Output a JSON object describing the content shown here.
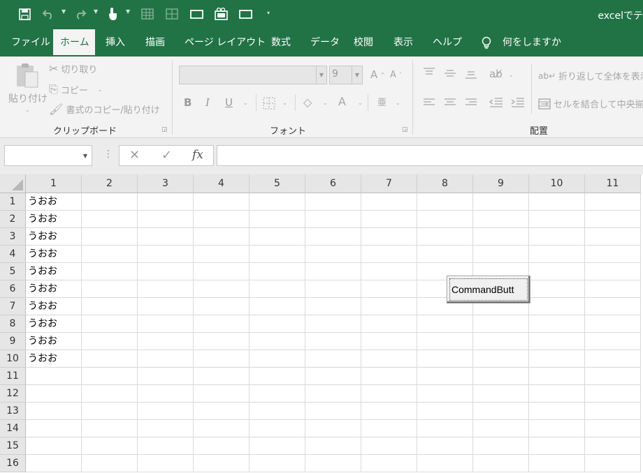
{
  "title_bar": {
    "document_title": "excelでテ",
    "qat_icons": [
      "save-icon",
      "undo-icon",
      "redo-icon",
      "touch-mode-icon",
      "table-grid-icon",
      "table-grid-icon",
      "rectangle-icon",
      "camera-icon",
      "rectangle-icon",
      "customize-qat-icon"
    ]
  },
  "ribbon_tabs": {
    "items": [
      "ファイル",
      "ホーム",
      "挿入",
      "描画",
      "ページ レイアウト",
      "数式",
      "データ",
      "校閲",
      "表示",
      "ヘルプ"
    ],
    "active": "ホーム",
    "tell_me": "何をしますか"
  },
  "clipboard": {
    "paste": "貼り付け",
    "cut": "切り取り",
    "copy": "コピー",
    "format_painter": "書式のコピー/貼り付け",
    "group_label": "クリップボード"
  },
  "font": {
    "font_name": "",
    "font_size": "9",
    "group_label": "フォント",
    "bold": "B",
    "italic": "I",
    "underline": "U",
    "font_color": "A"
  },
  "alignment": {
    "wrap_text": "折り返して全体を表示",
    "merge_center": "セルを結合して中央揃え",
    "group_label": "配置"
  },
  "formula_bar": {
    "name_box": "",
    "formula": "",
    "fx": "fx"
  },
  "sheet": {
    "column_headers": [
      "1",
      "2",
      "3",
      "4",
      "5",
      "6",
      "7",
      "8",
      "9",
      "10",
      "11"
    ],
    "row_headers": [
      "1",
      "2",
      "3",
      "4",
      "5",
      "6",
      "7",
      "8",
      "9",
      "10",
      "11",
      "12",
      "13",
      "14",
      "15",
      "16"
    ],
    "column_a_values": [
      "うおお",
      "うおお",
      "うおお",
      "うおお",
      "うおお",
      "うおお",
      "うおお",
      "うおお",
      "うおお",
      "うおお",
      "",
      "",
      "",
      "",
      "",
      ""
    ]
  },
  "command_button": {
    "caption": "CommandButt"
  },
  "colors": {
    "accent": "#217346",
    "ribbon_bg": "#f3f3f3",
    "header_bg": "#e6e6e6",
    "gridline": "#dadada"
  }
}
